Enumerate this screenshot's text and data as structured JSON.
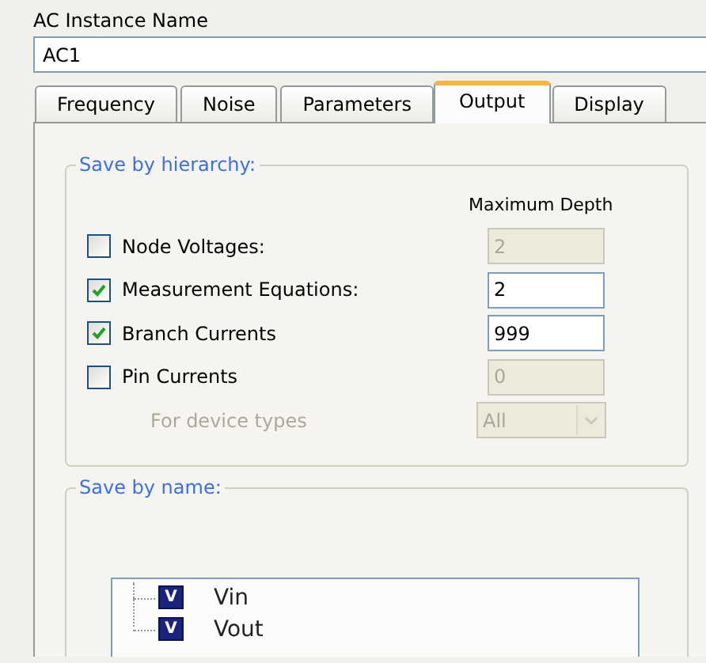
{
  "instance_name": {
    "label": "AC Instance Name",
    "value": "AC1"
  },
  "tabs": [
    {
      "label": "Frequency",
      "selected": false
    },
    {
      "label": "Noise",
      "selected": false
    },
    {
      "label": "Parameters",
      "selected": false
    },
    {
      "label": "Output",
      "selected": true
    },
    {
      "label": "Display",
      "selected": false
    }
  ],
  "save_by_hierarchy": {
    "title": "Save by hierarchy:",
    "depth_heading": "Maximum Depth",
    "rows": [
      {
        "kind": "check",
        "label": "Node Voltages:",
        "checked": false,
        "depth": "2"
      },
      {
        "kind": "check",
        "label": "Measurement Equations:",
        "checked": true,
        "depth": "2"
      },
      {
        "kind": "check",
        "label": "Branch Currents",
        "checked": true,
        "depth": "999"
      },
      {
        "kind": "check",
        "label": "Pin Currents",
        "checked": false,
        "depth": "0"
      },
      {
        "kind": "select",
        "label": "For device types",
        "disabled": true,
        "value": "All"
      }
    ]
  },
  "save_by_name": {
    "title": "Save by name:",
    "items": [
      {
        "badge": "V",
        "label": "Vin"
      },
      {
        "badge": "V",
        "label": "Vout"
      }
    ]
  }
}
